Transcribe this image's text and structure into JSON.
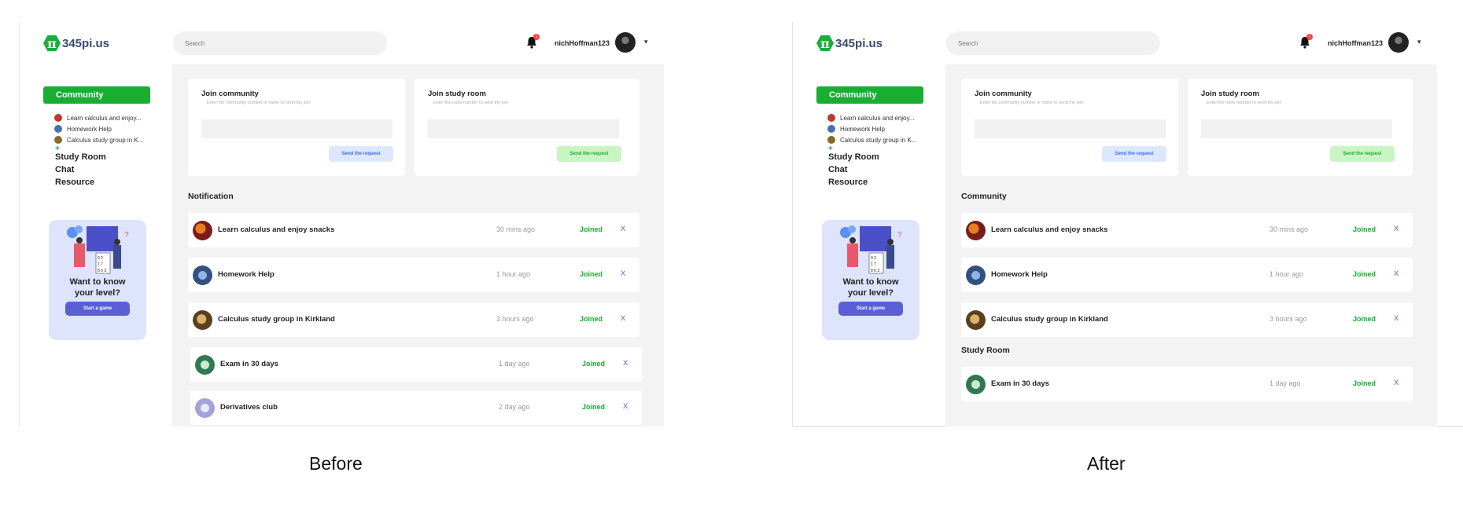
{
  "captions": {
    "before": "Before",
    "after": "After"
  },
  "app": {
    "logo_symbol": "π",
    "logo_text": "345pi.us",
    "search_placeholder": "Search",
    "notification_count": "1",
    "username": "nichHoffman123",
    "caret": "▾"
  },
  "sidebar": {
    "community_label": "Community",
    "communities": [
      {
        "label": "Learn calculus and enjoy...",
        "color": "#c0392b"
      },
      {
        "label": "Homework Help",
        "color": "#4a6fb5"
      },
      {
        "label": "Calculus study group in K...",
        "color": "#8a6a2a"
      }
    ],
    "add_symbol": "+",
    "items": [
      "Study Room",
      "Chat",
      "Resource"
    ]
  },
  "game_card": {
    "title_line1": "Want to know",
    "title_line2": "your level?",
    "button_label": "Start a game"
  },
  "join_cards": {
    "community": {
      "title": "Join community",
      "hint": "Enter the community number or name to send the join",
      "button": "Send the request"
    },
    "study_room": {
      "title": "Join study room",
      "hint": "Enter the room number to send the join",
      "button": "Send the request"
    }
  },
  "before": {
    "section_title": "Notification",
    "rows": [
      {
        "name": "Learn calculus and enjoy snacks",
        "time": "30 mins ago",
        "status": "Joined",
        "close": "X"
      },
      {
        "name": "Homework Help",
        "time": "1 hour ago",
        "status": "Joined",
        "close": "X"
      },
      {
        "name": "Calculus study group in Kirkland",
        "time": "3 hours ago",
        "status": "Joined",
        "close": "X"
      },
      {
        "name": "Exam in 30 days",
        "time": "1 day ago",
        "status": "Joined",
        "close": "X"
      },
      {
        "name": "Derivatives club",
        "time": "2 day ago",
        "status": "Joined",
        "close": "X"
      }
    ]
  },
  "after": {
    "community_title": "Community",
    "community_rows": [
      {
        "name": "Learn calculus and enjoy snacks",
        "time": "30 mins ago",
        "status": "Joined",
        "close": "X"
      },
      {
        "name": "Homework Help",
        "time": "1 hour ago",
        "status": "Joined",
        "close": "X"
      },
      {
        "name": "Calculus study group in Kirkland",
        "time": "3 hours ago",
        "status": "Joined",
        "close": "X"
      }
    ],
    "study_room_title": "Study Room",
    "study_room_rows": [
      {
        "name": "Exam in 30 days",
        "time": "1 day ago",
        "status": "Joined",
        "close": "X"
      }
    ]
  },
  "colors": {
    "brand_green": "#19ad32",
    "accent_purple": "#5b5fd6",
    "main_bg": "#f3f3f3"
  }
}
